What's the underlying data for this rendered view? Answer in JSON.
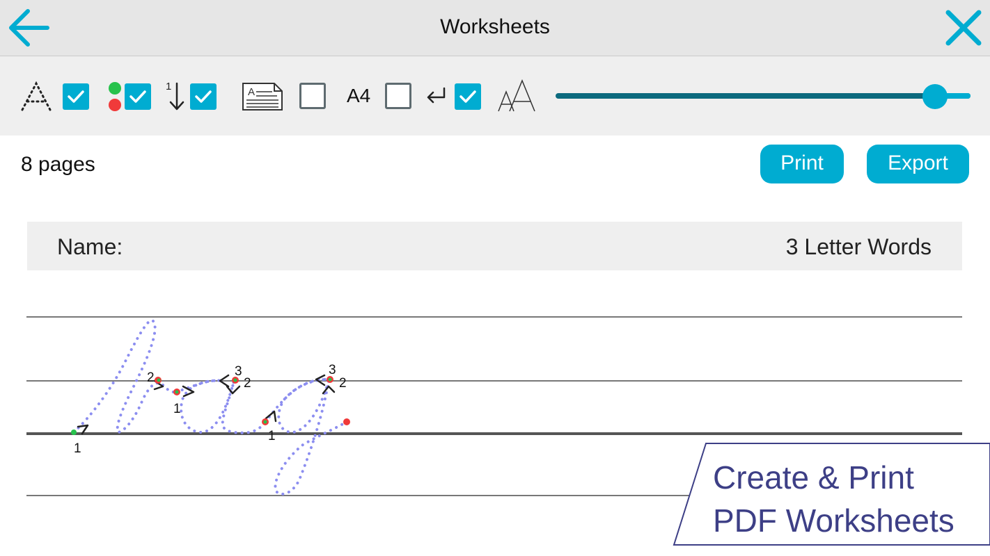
{
  "titlebar": {
    "title": "Worksheets"
  },
  "toolbar": {
    "options": [
      {
        "icon": "dotted-letter-icon",
        "checked": true
      },
      {
        "icon": "start-end-dots-icon",
        "checked": true
      },
      {
        "icon": "stroke-order-icon",
        "checked": true
      },
      {
        "icon": "text-lines-icon",
        "checked": false
      },
      {
        "icon": "paper-size-icon",
        "label": "A4",
        "checked": false
      },
      {
        "icon": "return-icon",
        "checked": true
      },
      {
        "icon": "font-size-icon"
      }
    ],
    "font_size_level": 0.9
  },
  "pages_bar": {
    "count_text": "8 pages",
    "print_label": "Print",
    "export_label": "Export"
  },
  "worksheet": {
    "name_label": "Name:",
    "title": "3 Letter Words"
  },
  "banner": {
    "line1": "Create & Print",
    "line2": "PDF Worksheets"
  },
  "colors": {
    "accent": "#00acd1",
    "slider_track": "#0c6a7e",
    "trace": "#8c8ef0",
    "banner_text": "#3d3f86"
  }
}
